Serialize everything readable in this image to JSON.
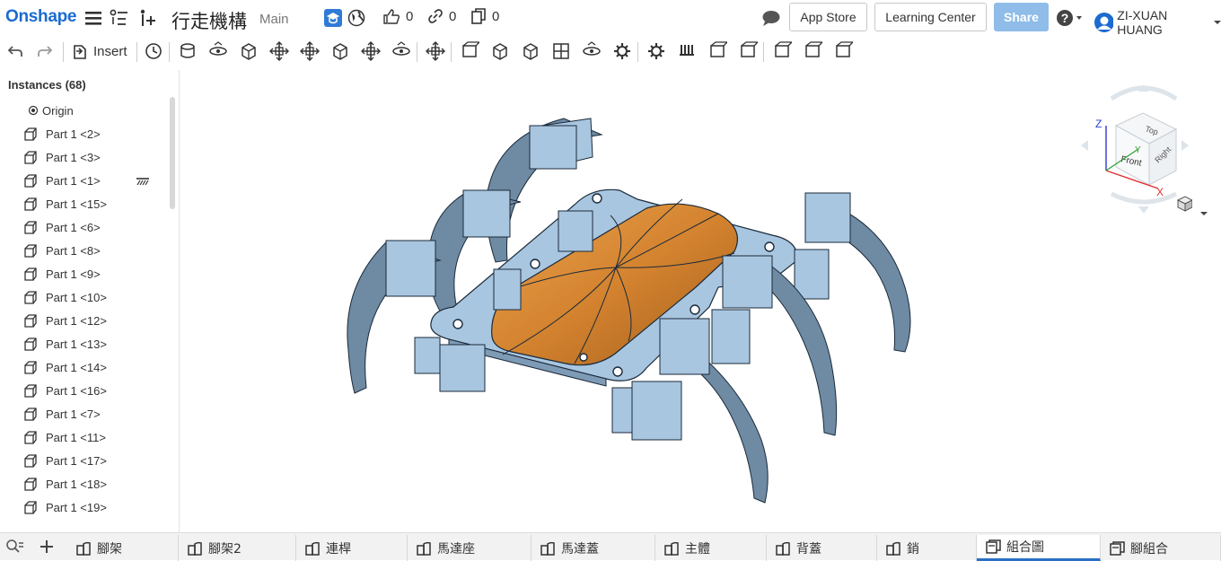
{
  "app": {
    "logo": "Onshape"
  },
  "document": {
    "title": "行走機構",
    "branch": "Main"
  },
  "counters": {
    "likes": "0",
    "links": "0",
    "copies": "0"
  },
  "header": {
    "app_store": "App Store",
    "learning_center": "Learning Center",
    "share": "Share",
    "user_name": "ZI-XUAN HUANG"
  },
  "toolbar": {
    "insert_label": "Insert",
    "icons": [
      "undo-icon",
      "redo-icon",
      "insert-icon",
      "history-icon",
      "fastened-mate-icon",
      "revolute-mate-icon",
      "slider-mate-icon",
      "planar-mate-icon",
      "cylindrical-mate-icon",
      "pin-slot-mate-icon",
      "ball-mate-icon",
      "parallel-mate-icon",
      "mate-connector-icon",
      "group-icon",
      "replicate-icon",
      "linear-pattern-icon",
      "circular-pattern-icon",
      "exploded-view-icon",
      "named-positions-icon",
      "gear-relation-icon",
      "rack-relation-icon",
      "screw-relation-icon",
      "linear-relation-icon",
      "measure-icon",
      "section-view-icon",
      "display-states-icon",
      "configuration-icon"
    ]
  },
  "instances": {
    "header": "Instances (68)",
    "items": [
      {
        "label": "Origin",
        "icon": "origin-icon"
      },
      {
        "label": "Part 1 <2>",
        "icon": "part-icon"
      },
      {
        "label": "Part 1 <3>",
        "icon": "part-icon"
      },
      {
        "label": "Part 1 <1>",
        "icon": "part-icon",
        "fixed": true
      },
      {
        "label": "Part 1 <15>",
        "icon": "part-icon"
      },
      {
        "label": "Part 1 <6>",
        "icon": "part-icon"
      },
      {
        "label": "Part 1 <8>",
        "icon": "part-icon"
      },
      {
        "label": "Part 1 <9>",
        "icon": "part-icon"
      },
      {
        "label": "Part 1 <10>",
        "icon": "part-icon"
      },
      {
        "label": "Part 1 <12>",
        "icon": "part-icon"
      },
      {
        "label": "Part 1 <13>",
        "icon": "part-icon"
      },
      {
        "label": "Part 1 <14>",
        "icon": "part-icon"
      },
      {
        "label": "Part 1 <16>",
        "icon": "part-icon"
      },
      {
        "label": "Part 1 <7>",
        "icon": "part-icon"
      },
      {
        "label": "Part 1 <11>",
        "icon": "part-icon"
      },
      {
        "label": "Part 1 <17>",
        "icon": "part-icon"
      },
      {
        "label": "Part 1 <18>",
        "icon": "part-icon"
      },
      {
        "label": "Part 1 <19>",
        "icon": "part-icon"
      }
    ]
  },
  "viewcube": {
    "top": "Top",
    "front": "Front",
    "right": "Right",
    "x": "X",
    "y": "Y",
    "z": "Z"
  },
  "colors": {
    "brand": "#1b6bd0",
    "part_blue": "#a9c6e0",
    "shell_orange": "#d9883a",
    "share_disabled": "#8fbce8",
    "active_tab": "#2a6fc4"
  },
  "tabs": [
    {
      "label": "腳架",
      "type": "part-studio"
    },
    {
      "label": "腳架2",
      "type": "part-studio"
    },
    {
      "label": "連桿",
      "type": "part-studio"
    },
    {
      "label": "馬達座",
      "type": "part-studio"
    },
    {
      "label": "馬達蓋",
      "type": "part-studio"
    },
    {
      "label": "主體",
      "type": "part-studio"
    },
    {
      "label": "背蓋",
      "type": "part-studio"
    },
    {
      "label": "銷",
      "type": "part-studio"
    },
    {
      "label": "組合圖",
      "type": "assembly",
      "active": true
    },
    {
      "label": "腳組合",
      "type": "assembly"
    }
  ]
}
